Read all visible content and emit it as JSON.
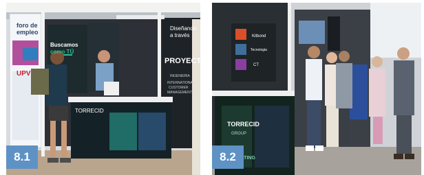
{
  "figures": [
    {
      "label": "8.1",
      "signs": {
        "foro_line1": "foro de",
        "foro_line2": "empleo",
        "upv": "UPV",
        "buscamos_line1": "Buscamos",
        "buscamos_line2": "como TÚ",
        "disenando_line1": "Diseñando",
        "disenando_line2": "a través",
        "proyecta": "PROYECTA",
        "ingenieria": "INGENIERIA",
        "international": "INTERNATIONAL",
        "customer": "CUSTOMER",
        "management": "MANAGEMENT",
        "counter_logo": "TORRECID"
      }
    },
    {
      "label": "8.2",
      "signs": {
        "tile_brand_1": "Kitbond",
        "tile_brand_2": "Tecnologia",
        "tile_brand_3": "CT",
        "counter_logo": "TORRECID",
        "counter_sub": "GROUP",
        "counter_tag": "INNOVATING"
      }
    }
  ]
}
